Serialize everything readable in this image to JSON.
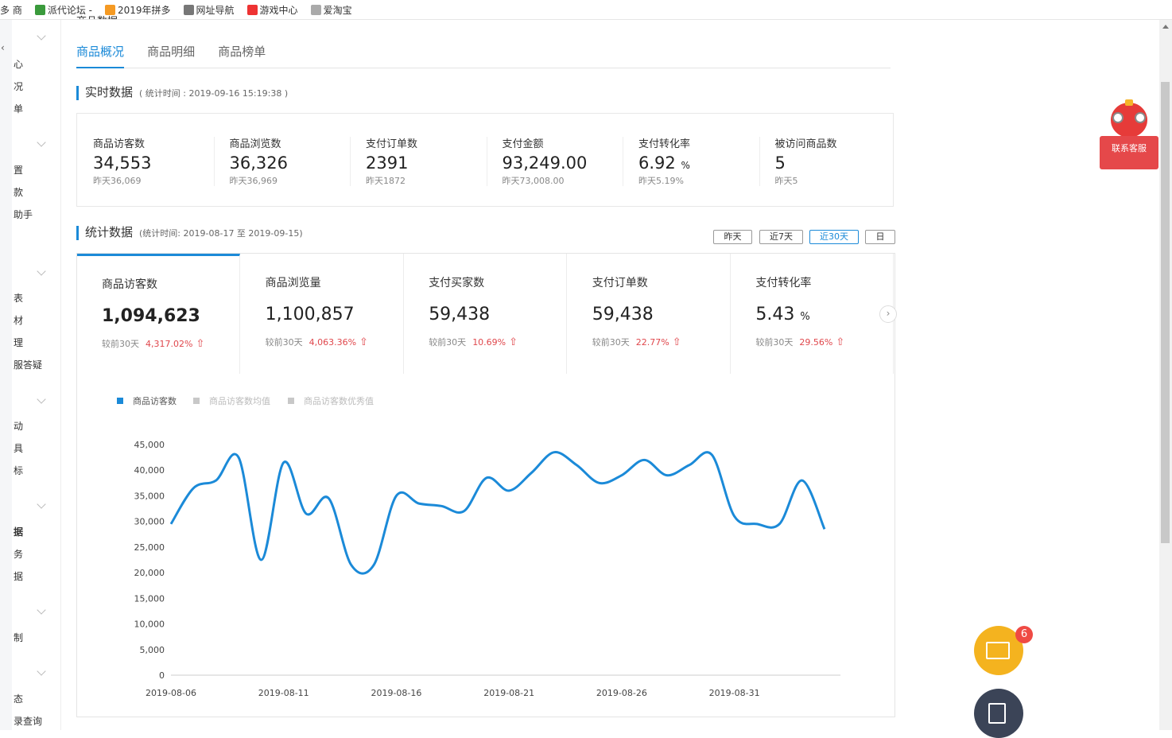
{
  "bookmarks": [
    {
      "label": "多 商",
      "icon": "none"
    },
    {
      "label": "派代论坛 -",
      "icon": "paidai-icon"
    },
    {
      "label": "2019年拼多",
      "icon": "pinduoduo-icon"
    },
    {
      "label": "网址导航",
      "icon": "globe-icon"
    },
    {
      "label": "游戏中心",
      "icon": "game-icon"
    },
    {
      "label": "爱淘宝",
      "icon": "page-icon"
    }
  ],
  "sidebar": {
    "back": "‹",
    "items": [
      "心",
      "况",
      "单",
      "置",
      "款",
      "助手",
      "表",
      "材",
      "理",
      "服答疑",
      "动",
      "具",
      "标",
      "据",
      "务",
      "据",
      "制",
      "态",
      "录查询"
    ]
  },
  "page_title_cut": "商品数据",
  "tabs": [
    "商品概况",
    "商品明细",
    "商品榜单"
  ],
  "realtime": {
    "title": "实时数据",
    "note": "( 统计时间 : 2019-09-16 15:19:38 )",
    "metrics": [
      {
        "label": "商品访客数",
        "value": "34,553",
        "unit": "",
        "prev": "昨天36,069"
      },
      {
        "label": "商品浏览数",
        "value": "36,326",
        "unit": "",
        "prev": "昨天36,969"
      },
      {
        "label": "支付订单数",
        "value": "2391",
        "unit": "",
        "prev": "昨天1872"
      },
      {
        "label": "支付金额",
        "value": "93,249.00",
        "unit": "",
        "prev": "昨天73,008.00"
      },
      {
        "label": "支付转化率",
        "value": "6.92",
        "unit": "%",
        "prev": "昨天5.19%"
      },
      {
        "label": "被访问商品数",
        "value": "5",
        "unit": "",
        "prev": "昨天5"
      }
    ]
  },
  "stats": {
    "title": "统计数据",
    "note": "(统计时间: 2019-08-17 至 2019-09-15)",
    "ranges": [
      "昨天",
      "近7天",
      "近30天",
      "日"
    ],
    "active_range": "近30天",
    "cards": [
      {
        "label": "商品访客数",
        "value": "1,094,623",
        "unit": "",
        "cmp": "较前30天",
        "pct": "4,317.02%"
      },
      {
        "label": "商品浏览量",
        "value": "1,100,857",
        "unit": "",
        "cmp": "较前30天",
        "pct": "4,063.36%"
      },
      {
        "label": "支付买家数",
        "value": "59,438",
        "unit": "",
        "cmp": "较前30天",
        "pct": "10.69%"
      },
      {
        "label": "支付订单数",
        "value": "59,438",
        "unit": "",
        "cmp": "较前30天",
        "pct": "22.77%"
      },
      {
        "label": "支付转化率",
        "value": "5.43",
        "unit": "%",
        "cmp": "较前30天",
        "pct": "29.56%"
      }
    ],
    "up_arrow": "⇧",
    "next_arrow": "›"
  },
  "colors": {
    "accent": "#1b8ad8",
    "up": "#e0474c",
    "legend_off": "#c8c8c8",
    "service": "#e5484a",
    "mail": "#f4b31f"
  },
  "chart_data": {
    "type": "line",
    "legend": [
      {
        "name": "商品访客数",
        "active": true
      },
      {
        "name": "商品访客数均值",
        "active": false
      },
      {
        "name": "商品访客数优秀值",
        "active": false
      }
    ],
    "legend_position": "top-left",
    "y_ticks": [
      "45,000",
      "40,000",
      "35,000",
      "30,000",
      "25,000",
      "20,000",
      "15,000",
      "10,000",
      "5,000",
      "0"
    ],
    "ylim": [
      0,
      45000
    ],
    "x_ticks": [
      "2019-08-06",
      "2019-08-11",
      "2019-08-16",
      "2019-08-21",
      "2019-08-26",
      "2019-08-31"
    ],
    "grid": false,
    "series": [
      {
        "name": "商品访客数",
        "x": [
          "2019-08-06",
          "2019-08-07",
          "2019-08-08",
          "2019-08-09",
          "2019-08-10",
          "2019-08-11",
          "2019-08-12",
          "2019-08-13",
          "2019-08-14",
          "2019-08-15",
          "2019-08-16",
          "2019-08-17",
          "2019-08-18",
          "2019-08-19",
          "2019-08-20",
          "2019-08-21",
          "2019-08-22",
          "2019-08-23",
          "2019-08-24",
          "2019-08-25",
          "2019-08-26",
          "2019-08-27",
          "2019-08-28",
          "2019-08-29",
          "2019-08-30",
          "2019-08-31",
          "2019-09-01",
          "2019-09-02",
          "2019-09-03",
          "2019-09-04"
        ],
        "values": [
          29500,
          36500,
          38000,
          42500,
          22500,
          41500,
          31500,
          34500,
          21500,
          21500,
          35000,
          33500,
          33000,
          32000,
          38500,
          36000,
          39500,
          43500,
          41000,
          37500,
          39000,
          42000,
          39000,
          41000,
          43000,
          31000,
          29500,
          29500,
          38000,
          28500
        ]
      }
    ]
  },
  "service": {
    "label": "联系客服"
  },
  "mail_badge": "6"
}
